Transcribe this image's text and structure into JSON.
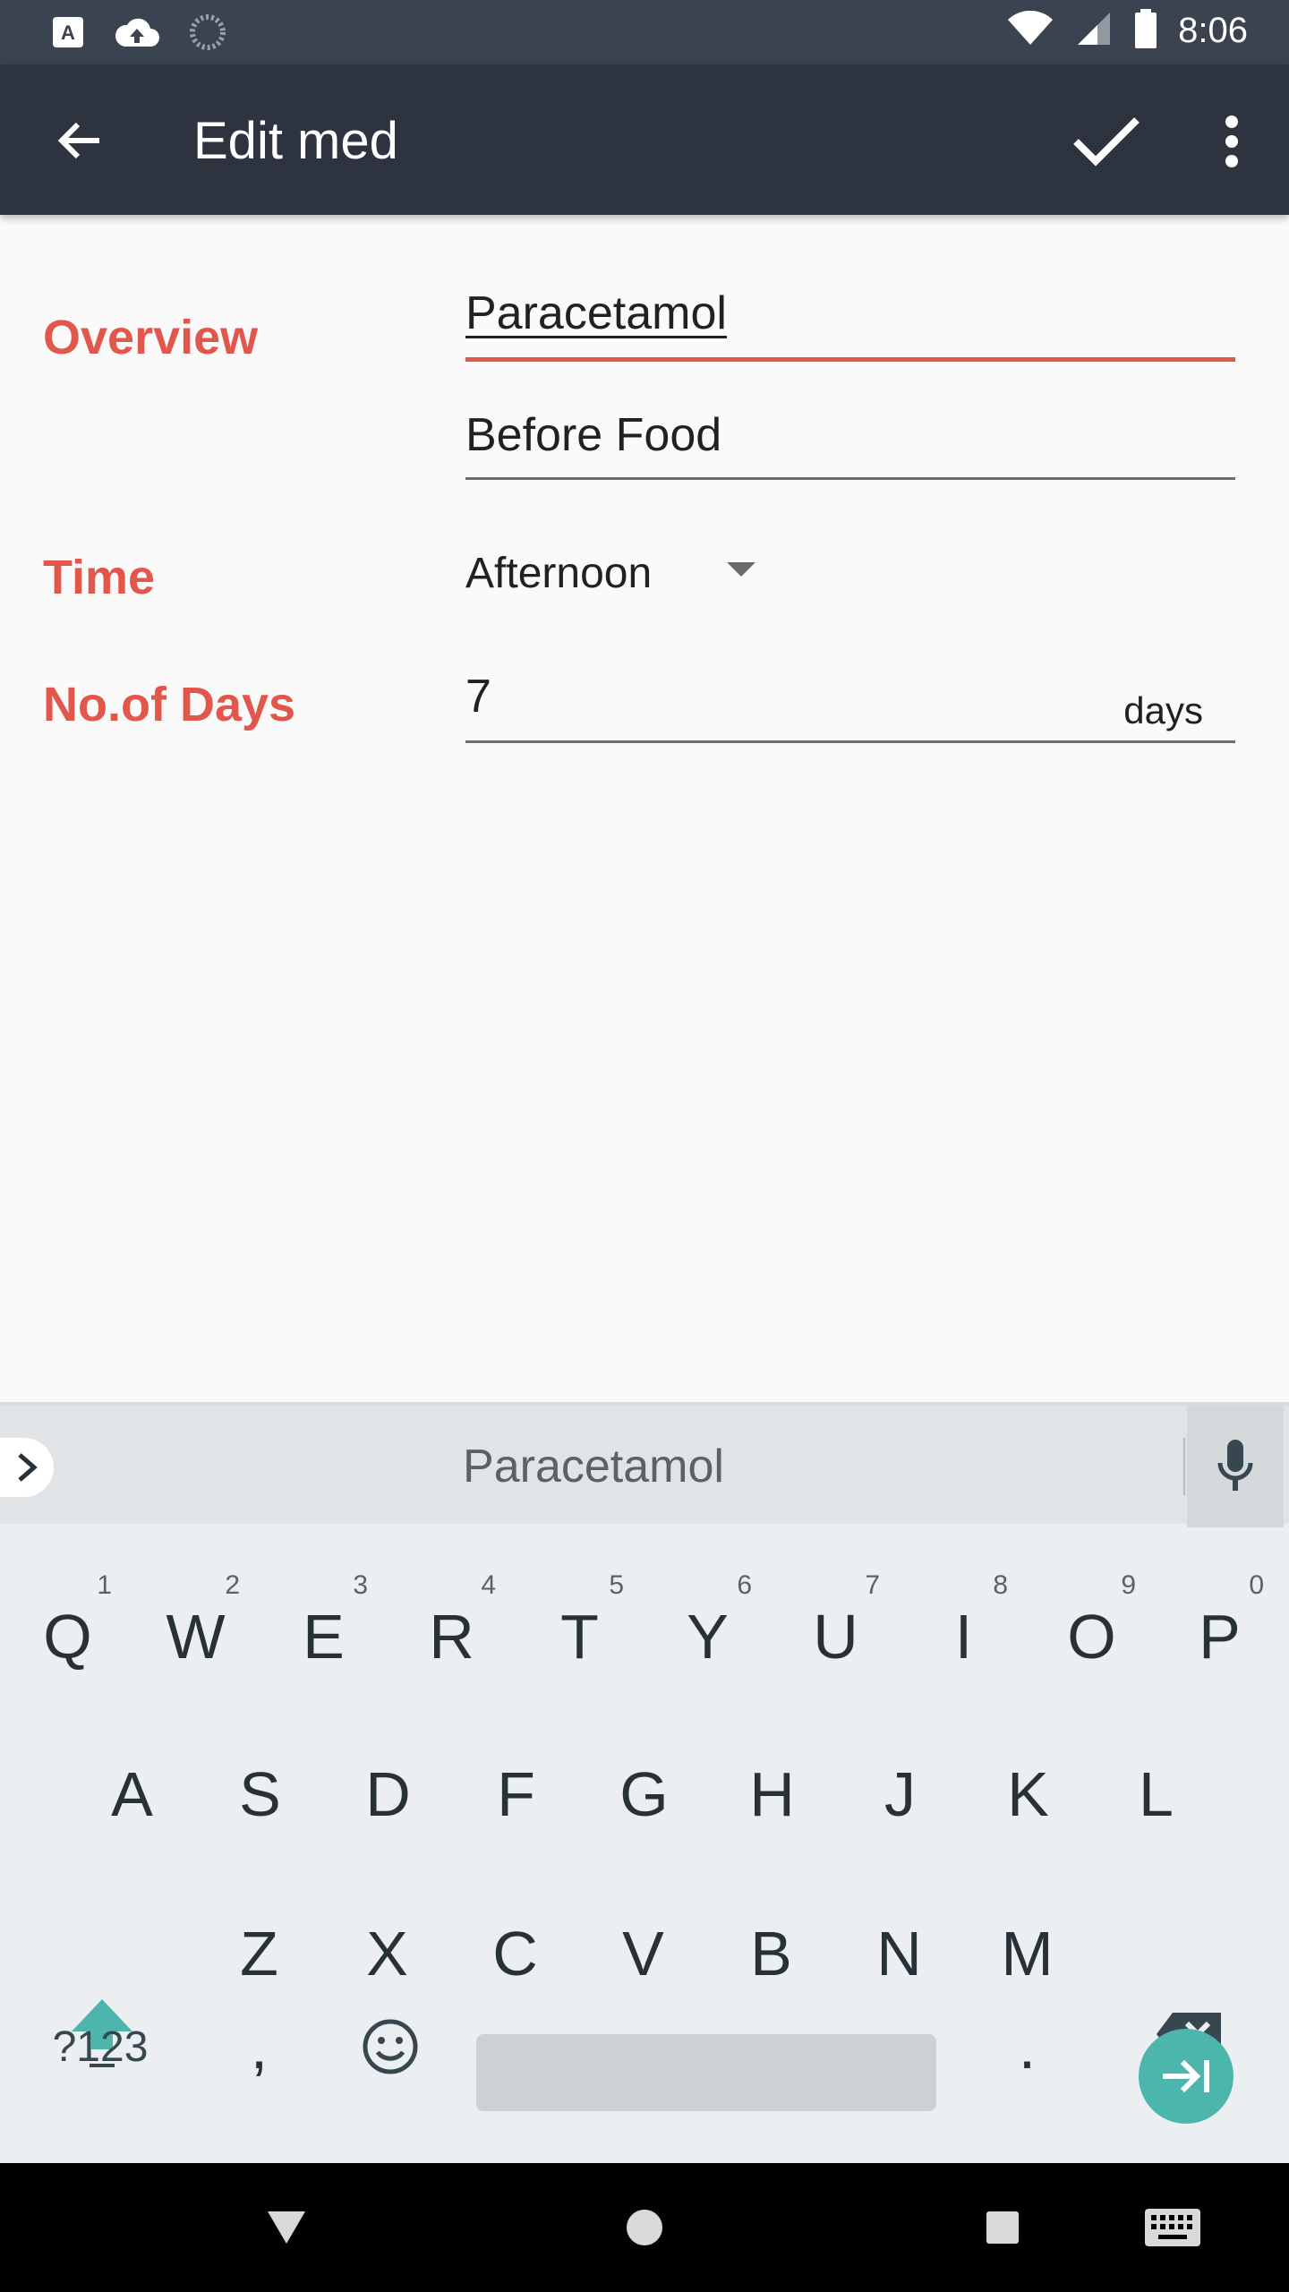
{
  "status_bar": {
    "time": "8:06",
    "icons": [
      "accessibility-icon",
      "cloud-upload-icon",
      "sync-icon",
      "wifi-icon",
      "signal-icon",
      "battery-icon"
    ]
  },
  "app_bar": {
    "title": "Edit med",
    "actions": [
      "back-arrow-icon",
      "check-icon",
      "more-vert-icon"
    ]
  },
  "form": {
    "overview_label": "Overview",
    "name_value": "Paracetamol",
    "food_value": "Before Food",
    "time_label": "Time",
    "time_value": "Afternoon",
    "days_label": "No.of Days",
    "days_value": "7",
    "days_suffix": "days"
  },
  "colors": {
    "accent": "#e2574c",
    "app_bar": "#2d3440",
    "status_bar": "#3b4350",
    "keyboard_accent": "#4db6ac"
  },
  "keyboard": {
    "suggestion": "Paracetamol",
    "row1": [
      {
        "k": "Q",
        "h": "1"
      },
      {
        "k": "W",
        "h": "2"
      },
      {
        "k": "E",
        "h": "3"
      },
      {
        "k": "R",
        "h": "4"
      },
      {
        "k": "T",
        "h": "5"
      },
      {
        "k": "Y",
        "h": "6"
      },
      {
        "k": "U",
        "h": "7"
      },
      {
        "k": "I",
        "h": "8"
      },
      {
        "k": "O",
        "h": "9"
      },
      {
        "k": "P",
        "h": "0"
      }
    ],
    "row2": [
      "A",
      "S",
      "D",
      "F",
      "G",
      "H",
      "J",
      "K",
      "L"
    ],
    "row3": [
      "Z",
      "X",
      "C",
      "V",
      "B",
      "N",
      "M"
    ],
    "symbols_label": "?123",
    "comma": ",",
    "period": "."
  }
}
